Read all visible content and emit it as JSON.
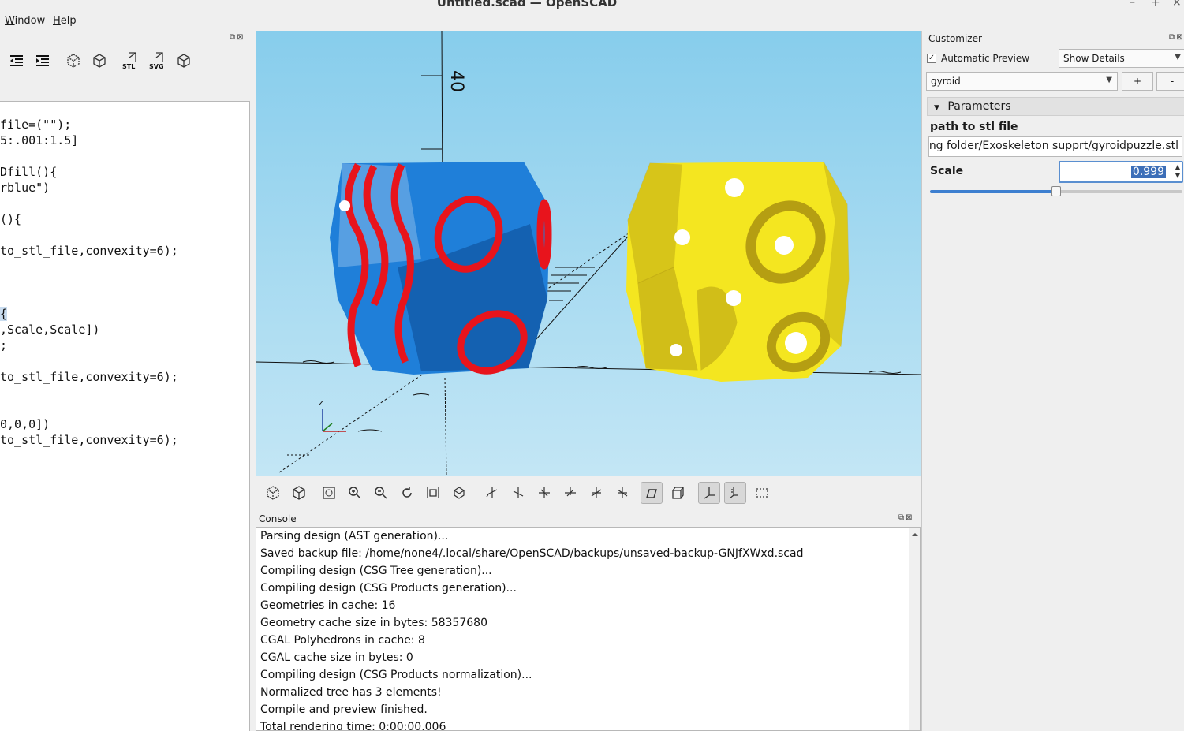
{
  "window": {
    "title": "Untitled.scad — OpenSCAD",
    "controls": [
      "–",
      "+",
      "×"
    ]
  },
  "menu": {
    "items": [
      {
        "label": "Window",
        "mnemonic": "W"
      },
      {
        "label": "Help",
        "mnemonic": "H"
      }
    ]
  },
  "editor": {
    "toolbar_icons": [
      "unindent-icon",
      "indent-icon",
      "preview-icon",
      "render-icon",
      "export-stl-icon",
      "export-svg-icon",
      "send-to-print-icon"
    ],
    "stl_label": "STL",
    "svg_label": "SVG",
    "lines": [
      {
        "text": "file=(\"\");",
        "highlight": false
      },
      {
        "text": "5:.001:1.5]",
        "highlight": false
      },
      {
        "text": "",
        "highlight": false
      },
      {
        "text": "Dfill(){",
        "highlight": false
      },
      {
        "text": "rblue\")",
        "highlight": false
      },
      {
        "text": "",
        "highlight": false
      },
      {
        "text": "(){",
        "highlight": false
      },
      {
        "text": "",
        "highlight": false
      },
      {
        "text": "to_stl_file,convexity=6);",
        "highlight": false
      },
      {
        "text": "",
        "highlight": false
      },
      {
        "text": "",
        "highlight": false
      },
      {
        "text": "",
        "highlight": false
      },
      {
        "text": "{",
        "highlight": true
      },
      {
        "text": ",Scale,Scale])",
        "highlight": false
      },
      {
        "text": ";",
        "highlight": false
      },
      {
        "text": "",
        "highlight": false
      },
      {
        "text": "to_stl_file,convexity=6);",
        "highlight": false
      },
      {
        "text": "",
        "highlight": false
      },
      {
        "text": "",
        "highlight": false
      },
      {
        "text": "0,0,0])",
        "highlight": false
      },
      {
        "text": "to_stl_file,convexity=6);",
        "highlight": false
      }
    ]
  },
  "viewport": {
    "background_top": "#87cdec",
    "background_bottom": "#c3e6f5",
    "axis_tick_label": "40",
    "gizmo_label": "z",
    "object_colors": {
      "blue": "#1f7fd9",
      "red": "#e8141c",
      "yellow": "#f4e620",
      "yellow_shadow": "#b59e12"
    }
  },
  "view_toolbar": {
    "buttons": [
      {
        "name": "preview-icon",
        "active": false
      },
      {
        "name": "render-icon",
        "active": false
      },
      {
        "name": "view-all-icon",
        "active": false
      },
      {
        "name": "zoom-in-icon",
        "active": false
      },
      {
        "name": "zoom-out-icon",
        "active": false
      },
      {
        "name": "reset-view-icon",
        "active": false
      },
      {
        "name": "view-center-icon",
        "active": false
      },
      {
        "name": "view-diagonal-icon",
        "active": false
      },
      {
        "name": "view-right-icon",
        "active": false
      },
      {
        "name": "view-left-icon",
        "active": false
      },
      {
        "name": "view-top-icon",
        "active": false
      },
      {
        "name": "view-bottom-icon",
        "active": false
      },
      {
        "name": "view-front-icon",
        "active": false
      },
      {
        "name": "view-back-icon",
        "active": false
      },
      {
        "name": "perspective-icon",
        "active": true
      },
      {
        "name": "orthogonal-icon",
        "active": false
      },
      {
        "name": "show-axes-icon",
        "active": true
      },
      {
        "name": "show-scale-markers-icon",
        "active": true
      },
      {
        "name": "show-edges-icon",
        "active": false
      }
    ]
  },
  "console": {
    "title": "Console",
    "lines": [
      "Parsing design (AST generation)...",
      "Saved backup file: /home/none4/.local/share/OpenSCAD/backups/unsaved-backup-GNJfXWxd.scad",
      "Compiling design (CSG Tree generation)...",
      "Compiling design (CSG Products generation)...",
      "Geometries in cache: 16",
      "Geometry cache size in bytes: 58357680",
      "CGAL Polyhedrons in cache: 8",
      "CGAL cache size in bytes: 0",
      "Compiling design (CSG Products normalization)...",
      "Normalized tree has 3 elements!",
      "Compile and preview finished.",
      "Total rendering time: 0:00:00.006"
    ]
  },
  "customizer": {
    "title": "Customizer",
    "auto_preview_label": "Automatic Preview",
    "auto_preview_checked": true,
    "details_select": "Show Details",
    "preset_select": "gyroid",
    "add_preset_label": "+",
    "remove_preset_label": "-",
    "section_title": "Parameters",
    "params": {
      "path_label": "path to stl file",
      "path_value": "ng folder/Exoskeleton supprt/gyroidpuzzle.stl",
      "scale_label": "Scale",
      "scale_value": "0.999",
      "scale_fraction": 0.5
    },
    "accent_color": "#3d7fd0"
  }
}
